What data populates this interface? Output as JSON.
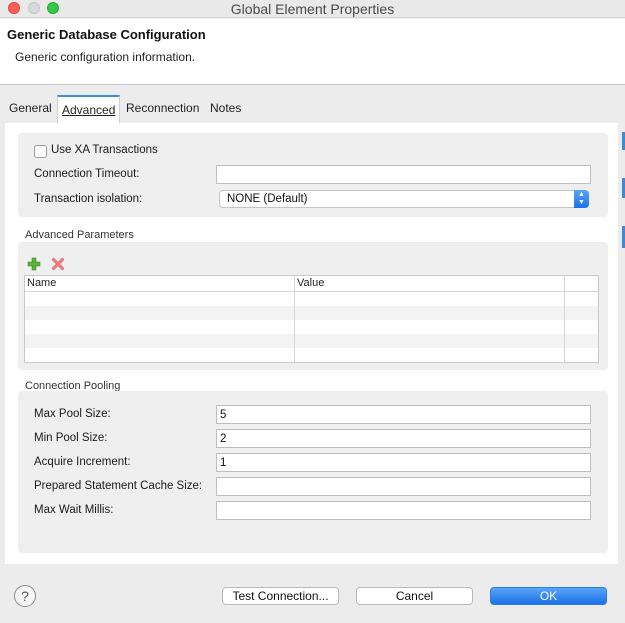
{
  "window": {
    "title": "Global Element Properties"
  },
  "header": {
    "title": "Generic Database Configuration",
    "subtitle": "Generic configuration information."
  },
  "tabs": [
    {
      "label": "General",
      "active": false
    },
    {
      "label": "Advanced",
      "active": true
    },
    {
      "label": "Reconnection",
      "active": false
    },
    {
      "label": "Notes",
      "active": false
    }
  ],
  "transactions": {
    "use_xa_label": "Use XA Transactions",
    "use_xa_checked": false,
    "timeout_label": "Connection Timeout:",
    "timeout_value": "",
    "isolation_label": "Transaction isolation:",
    "isolation_value": "NONE (Default)"
  },
  "advanced_params": {
    "section_label": "Advanced Parameters",
    "columns": [
      "Name",
      "Value"
    ],
    "rows": []
  },
  "pooling": {
    "section_label": "Connection Pooling",
    "fields": [
      {
        "label": "Max Pool Size:",
        "value": "5"
      },
      {
        "label": "Min Pool Size:",
        "value": "2"
      },
      {
        "label": "Acquire Increment:",
        "value": "1"
      },
      {
        "label": "Prepared Statement Cache Size:",
        "value": ""
      },
      {
        "label": "Max Wait Millis:",
        "value": ""
      }
    ]
  },
  "footer": {
    "help_glyph": "?",
    "test_label": "Test Connection...",
    "cancel_label": "Cancel",
    "ok_label": "OK"
  },
  "colors": {
    "accent": "#1a72e8",
    "close": "#fc5f57",
    "maximize": "#34c84a"
  }
}
